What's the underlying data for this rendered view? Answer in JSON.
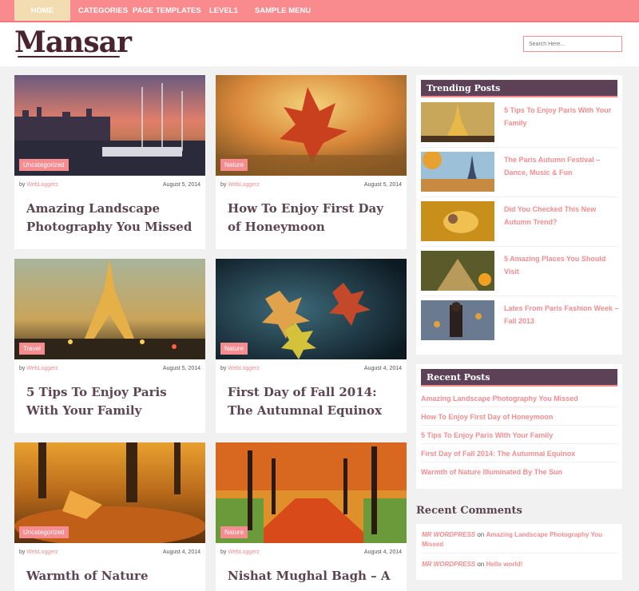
{
  "nav": {
    "items": [
      "HOME",
      "CATEGORIES",
      "PAGE TEMPLATES",
      "LEVEL1",
      "SAMPLE MENU"
    ]
  },
  "header": {
    "logo": "Mansar",
    "search_placeholder": "Search Here..."
  },
  "posts": [
    {
      "category": "Uncategorized",
      "by": "by",
      "author": "WebLoggerz",
      "date": "August 5, 2014",
      "title": "Amazing Landscape Photography You Missed"
    },
    {
      "category": "Nature",
      "by": "by",
      "author": "WebLoggerz",
      "date": "August 5, 2014",
      "title": "How To Enjoy First Day of Honeymoon"
    },
    {
      "category": "Travel",
      "by": "by",
      "author": "WebLoggerz",
      "date": "August 5, 2014",
      "title": "5 Tips To Enjoy Paris With Your Family"
    },
    {
      "category": "Nature",
      "by": "by",
      "author": "WebLoggerz",
      "date": "August 4, 2014",
      "title": "First Day of Fall 2014: The Autumnal Equinox"
    },
    {
      "category": "Uncategorized",
      "by": "by",
      "author": "WebLoggerz",
      "date": "August 4, 2014",
      "title": "Warmth of Nature"
    },
    {
      "category": "Nature",
      "by": "by",
      "author": "WebLoggerz",
      "date": "August 4, 2014",
      "title": "Nishat Mughal Bagh – A"
    }
  ],
  "trending": {
    "title": "Trending Posts",
    "items": [
      "5 Tips To Enjoy Paris With Your Family",
      "The Paris Autumn Festival – Dance, Music & Fun",
      "Did You Checked This New Autumn Trend?",
      "5 Amazing Places You Should Visit",
      "Lates From Paris Fashion Week – Fall 2013"
    ]
  },
  "recent_posts": {
    "title": "Recent Posts",
    "items": [
      "Amazing Landscape Photography You Missed",
      "How To Enjoy First Day of Honeymoon",
      "5 Tips To Enjoy Paris With Your Family",
      "First Day of Fall 2014: The Autumnal Equinox",
      "Warmth of Nature Illuminated By The Sun"
    ]
  },
  "recent_comments": {
    "title": "Recent Comments",
    "items": [
      {
        "who": "MR WORDPRESS",
        "on": "on",
        "post": "Amazing Landscape Photography You Missed"
      },
      {
        "who": "MR WORDPRESS",
        "on": "on",
        "post": "Hello world!"
      }
    ]
  },
  "colors": {
    "accent": "#f58c90",
    "nav": "#f98a8e",
    "active_nav": "#f2dcb1",
    "widget_head": "#5d4257",
    "title_text": "#5c4550"
  }
}
